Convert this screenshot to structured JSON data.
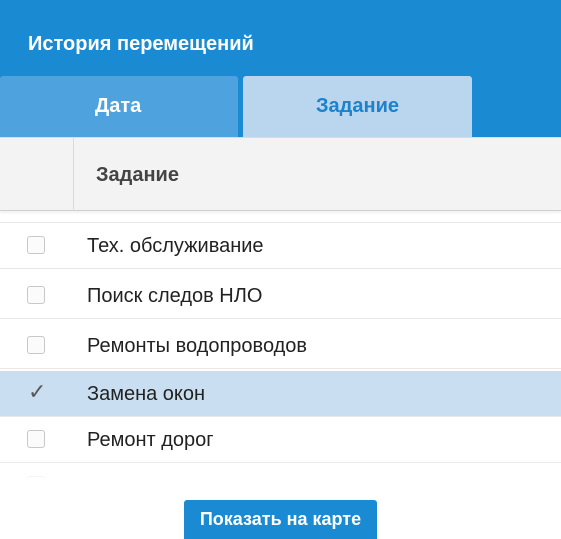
{
  "header": {
    "title": "История перемещений"
  },
  "tabs": [
    {
      "label": "Дата",
      "active": false
    },
    {
      "label": "Задание",
      "active": true
    }
  ],
  "table": {
    "column_header": "Задание",
    "rows": [
      {
        "label": "",
        "checked": false
      },
      {
        "label": "Тех. обслуживание",
        "checked": false
      },
      {
        "label": "Поиск следов НЛО",
        "checked": false
      },
      {
        "label": "Ремонты водопроводов",
        "checked": false
      },
      {
        "label": "Замена окон",
        "checked": true
      },
      {
        "label": "Ремонт дорог",
        "checked": false
      },
      {
        "label": "",
        "checked": false
      }
    ]
  },
  "actions": {
    "show_on_map_label": "Показать на карте"
  },
  "colors": {
    "accent": "#1a8bd3",
    "tab_inactive": "#4ea3de",
    "tab_active": "#bad6ee",
    "row_selected": "#c9def0"
  },
  "icons": {
    "checked": "checkmark-icon"
  }
}
